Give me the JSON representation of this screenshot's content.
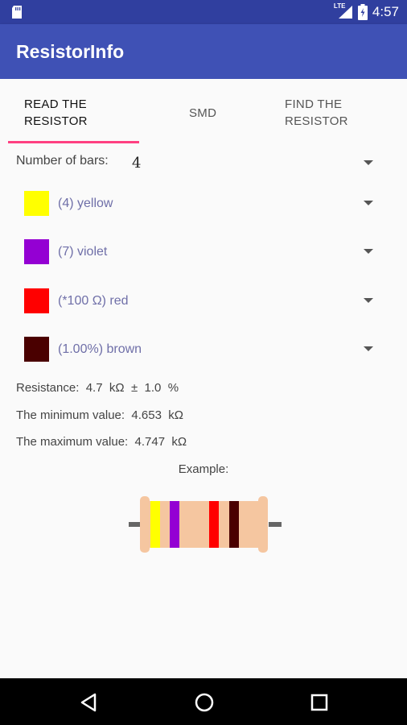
{
  "status_bar": {
    "time": "4:57",
    "network": "LTE",
    "icons": [
      "sd-card-icon",
      "lte-signal-icon",
      "battery-icon"
    ]
  },
  "app_bar": {
    "title": "ResistorInfo",
    "color": "#3f51b5"
  },
  "tabs": [
    {
      "label_line1": "READ THE",
      "label_line2": "RESISTOR",
      "active": true
    },
    {
      "label_line1": "SMD",
      "label_line2": "",
      "active": false
    },
    {
      "label_line1": "FIND THE",
      "label_line2": "RESISTOR",
      "active": false
    }
  ],
  "bars": {
    "label": "Number of bars:",
    "value": "4"
  },
  "bands": [
    {
      "label": "(4) yellow",
      "color": "#ffff00"
    },
    {
      "label": "(7) violet",
      "color": "#9400d3"
    },
    {
      "label": "(*100 Ω) red",
      "color": "#ff0000"
    },
    {
      "label": "(1.00%) brown",
      "color": "#4a0000"
    }
  ],
  "results": {
    "resistance": "Resistance:  4.7  kΩ  ±  1.0  %",
    "minimum": "The minimum value:  4.653  kΩ",
    "maximum": "The maximum value:  4.747  kΩ"
  },
  "example": {
    "label": "Example:",
    "body_color": "#f5c6a0",
    "lead_color": "#666666"
  },
  "nav_bar": {
    "icons": [
      "back-icon",
      "home-icon",
      "recents-icon"
    ]
  }
}
